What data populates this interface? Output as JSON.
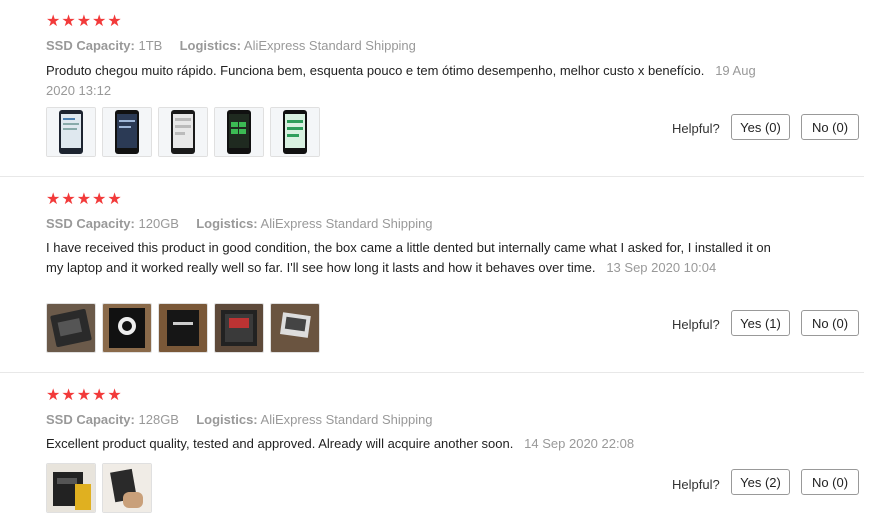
{
  "reviews": [
    {
      "rating": "★★★★★",
      "capacity_label": "SSD Capacity:",
      "capacity_value": "1TB",
      "logistics_label": "Logistics:",
      "logistics_value": "AliExpress Standard Shipping",
      "text": "Produto chegou muito rápido. Funciona bem, esquenta pouco e tem ótimo desempenho, melhor custo x benefício.",
      "date": "19 Aug 2020 13:12",
      "helpful_label": "Helpful?",
      "yes_label": "Yes (0)",
      "no_label": "No (0)",
      "photo_count": 5
    },
    {
      "rating": "★★★★★",
      "capacity_label": "SSD Capacity:",
      "capacity_value": "120GB",
      "logistics_label": "Logistics:",
      "logistics_value": "AliExpress Standard Shipping",
      "text": "I have received this product in good condition, the box came a little dented but internally came what I asked for, I installed it on my laptop and it worked really well so far. I'll see how long it lasts and how it behaves over time.",
      "date": "13 Sep 2020 10:04",
      "helpful_label": "Helpful?",
      "yes_label": "Yes (1)",
      "no_label": "No (0)",
      "photo_count": 5
    },
    {
      "rating": "★★★★★",
      "capacity_label": "SSD Capacity:",
      "capacity_value": "128GB",
      "logistics_label": "Logistics:",
      "logistics_value": "AliExpress Standard Shipping",
      "text": "Excellent product quality, tested and approved. Already will acquire another soon.",
      "date": "14 Sep 2020 22:08",
      "helpful_label": "Helpful?",
      "yes_label": "Yes (2)",
      "no_label": "No (0)",
      "photo_count": 2
    }
  ],
  "colors": {
    "star": "#f23a3a",
    "muted": "#999999",
    "text": "#222222",
    "divider": "#e8e8e8"
  }
}
